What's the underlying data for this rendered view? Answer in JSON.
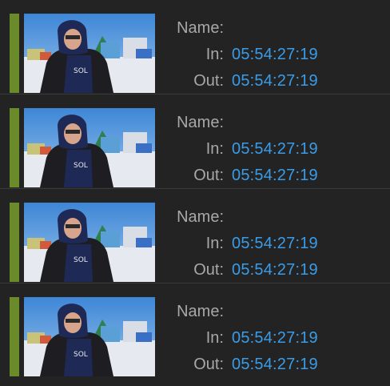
{
  "labels": {
    "name": "Name:",
    "in": "In:",
    "out": "Out:"
  },
  "colors": {
    "label_bar": "#6b8a2a",
    "timecode": "#3a9ce8",
    "field_label": "#a8a8a8",
    "background": "#232323"
  },
  "clips": [
    {
      "name": "",
      "in": "05:54:27:19",
      "out": "05:54:27:19",
      "thumbnail": "person-in-hooded-parka-snow-camp"
    },
    {
      "name": "",
      "in": "05:54:27:19",
      "out": "05:54:27:19",
      "thumbnail": "person-in-hooded-parka-snow-camp"
    },
    {
      "name": "",
      "in": "05:54:27:19",
      "out": "05:54:27:19",
      "thumbnail": "person-in-hooded-parka-snow-camp"
    },
    {
      "name": "",
      "in": "05:54:27:19",
      "out": "05:54:27:19",
      "thumbnail": "person-in-hooded-parka-snow-camp"
    }
  ]
}
